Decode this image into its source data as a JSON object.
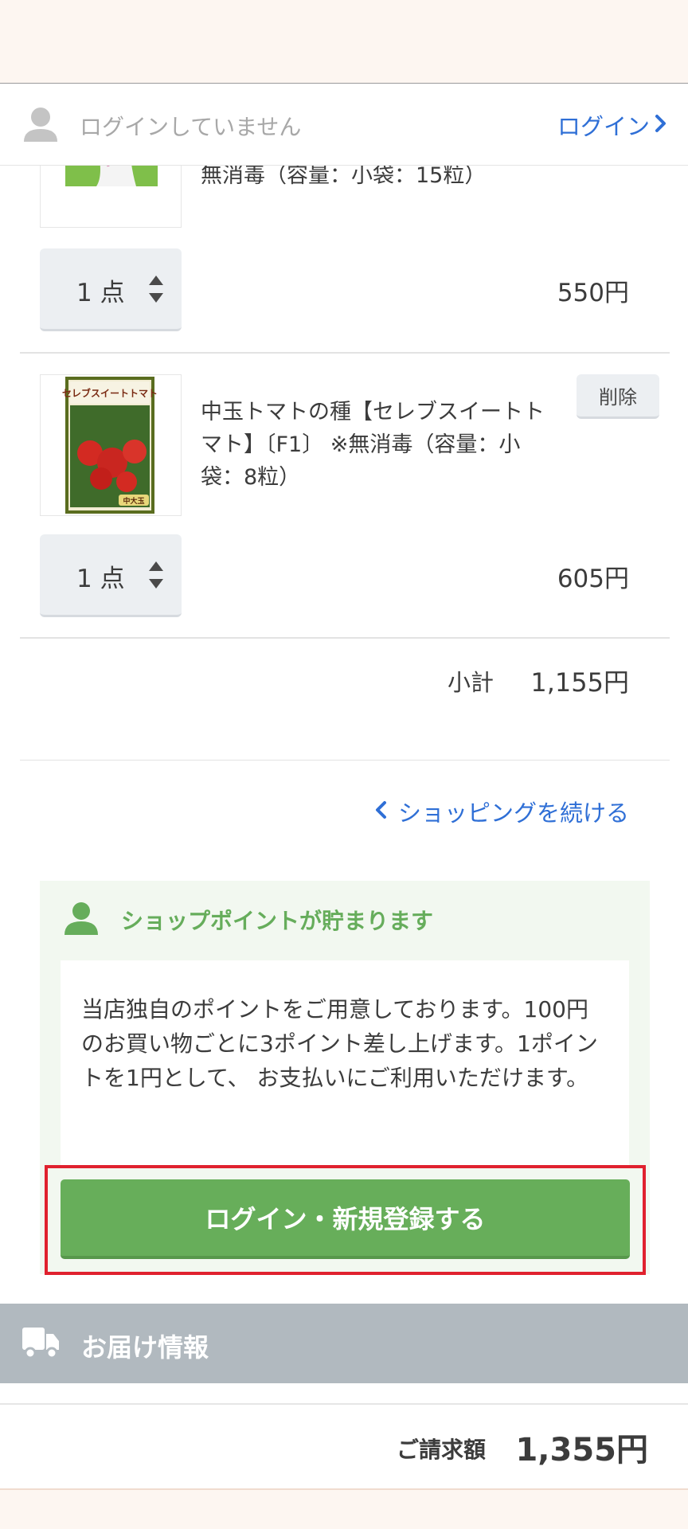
{
  "header": {
    "login_status": "ログインしていません",
    "login_link": "ログイン"
  },
  "cart": {
    "items": [
      {
        "name": "無消毒（容量：小袋：15粒）",
        "quantity": "1 点",
        "price": "550円"
      },
      {
        "name": "中玉トマトの種【セレブスイートトマト】〔F1〕 ※無消毒（容量：小袋：8粒）",
        "package_text": "セレブスイートトマト",
        "package_badge": "中大玉",
        "quantity": "1 点",
        "price": "605円",
        "delete_label": "削除"
      }
    ],
    "subtotal_label": "小計",
    "subtotal_value": "1,155円",
    "continue_label": "ショッピングを続ける"
  },
  "points": {
    "title": "ショップポイントが貯まります",
    "body": "当店独自のポイントをご用意しております。100円のお買い物ごとに3ポイント差し上げます。1ポイントを1円として、 お支払いにご利用いただけます。",
    "login_button": "ログイン・新規登録する"
  },
  "delivery": {
    "title": "お届け情報"
  },
  "total": {
    "label": "ご請求額",
    "value": "1,355円"
  },
  "colors": {
    "accent_green": "#67ae5a",
    "link_blue": "#2f6fd6",
    "highlight_red": "#e0212e"
  }
}
